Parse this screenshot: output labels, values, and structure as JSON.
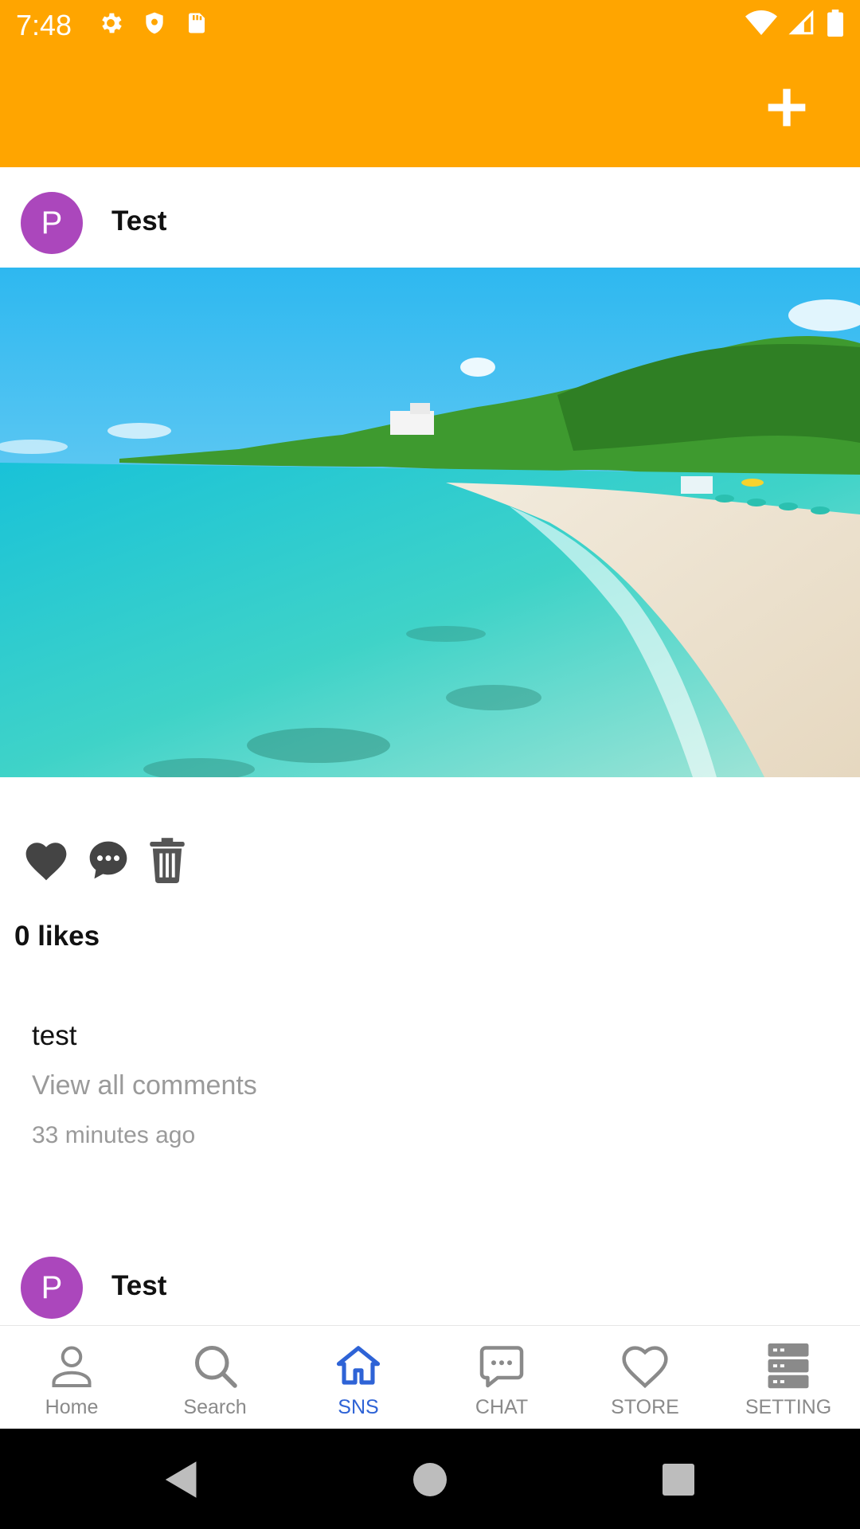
{
  "status_bar": {
    "time": "7:48"
  },
  "posts": [
    {
      "avatar_letter": "P",
      "username": "Test",
      "likes_text": "0 likes",
      "caption": "test",
      "view_comments": "View all  comments",
      "time_ago": "33 minutes ago"
    },
    {
      "avatar_letter": "P",
      "username": "Test"
    }
  ],
  "bottom_nav": {
    "items": [
      {
        "label": "Home",
        "icon": "person-icon"
      },
      {
        "label": "Search",
        "icon": "search-icon"
      },
      {
        "label": "SNS",
        "icon": "home-icon",
        "active": true
      },
      {
        "label": "CHAT",
        "icon": "chat-icon"
      },
      {
        "label": "STORE",
        "icon": "heart-icon"
      },
      {
        "label": "SETTING",
        "icon": "server-icon"
      }
    ]
  },
  "colors": {
    "header": "#FFA500",
    "avatar": "#AB47BC",
    "nav_active": "#2E63D6",
    "nav_inactive": "#8a8a8a"
  }
}
